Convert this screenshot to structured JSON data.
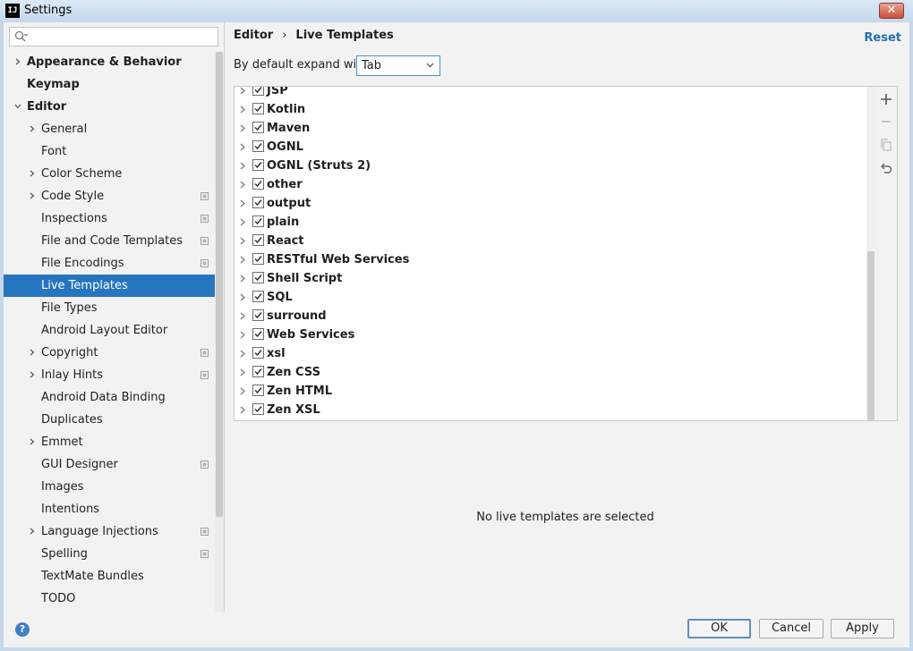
{
  "window": {
    "title": "Settings",
    "icon_text": "IJ",
    "close_label": "✕"
  },
  "search": {
    "placeholder": ""
  },
  "sidebar": {
    "items": [
      {
        "label": "Appearance & Behavior",
        "level": 0,
        "arrow": "right",
        "bold": true,
        "project": false,
        "selected": false
      },
      {
        "label": "Keymap",
        "level": 0,
        "arrow": "none",
        "bold": true,
        "project": false,
        "selected": false
      },
      {
        "label": "Editor",
        "level": 0,
        "arrow": "down",
        "bold": true,
        "project": false,
        "selected": false
      },
      {
        "label": "General",
        "level": 1,
        "arrow": "right",
        "bold": false,
        "project": false,
        "selected": false
      },
      {
        "label": "Font",
        "level": 1,
        "arrow": "none",
        "bold": false,
        "project": false,
        "selected": false
      },
      {
        "label": "Color Scheme",
        "level": 1,
        "arrow": "right",
        "bold": false,
        "project": false,
        "selected": false
      },
      {
        "label": "Code Style",
        "level": 1,
        "arrow": "right",
        "bold": false,
        "project": true,
        "selected": false
      },
      {
        "label": "Inspections",
        "level": 1,
        "arrow": "none",
        "bold": false,
        "project": true,
        "selected": false
      },
      {
        "label": "File and Code Templates",
        "level": 1,
        "arrow": "none",
        "bold": false,
        "project": true,
        "selected": false
      },
      {
        "label": "File Encodings",
        "level": 1,
        "arrow": "none",
        "bold": false,
        "project": true,
        "selected": false
      },
      {
        "label": "Live Templates",
        "level": 1,
        "arrow": "none",
        "bold": false,
        "project": false,
        "selected": true
      },
      {
        "label": "File Types",
        "level": 1,
        "arrow": "none",
        "bold": false,
        "project": false,
        "selected": false
      },
      {
        "label": "Android Layout Editor",
        "level": 1,
        "arrow": "none",
        "bold": false,
        "project": false,
        "selected": false
      },
      {
        "label": "Copyright",
        "level": 1,
        "arrow": "right",
        "bold": false,
        "project": true,
        "selected": false
      },
      {
        "label": "Inlay Hints",
        "level": 1,
        "arrow": "right",
        "bold": false,
        "project": true,
        "selected": false
      },
      {
        "label": "Android Data Binding",
        "level": 1,
        "arrow": "none",
        "bold": false,
        "project": false,
        "selected": false
      },
      {
        "label": "Duplicates",
        "level": 1,
        "arrow": "none",
        "bold": false,
        "project": false,
        "selected": false
      },
      {
        "label": "Emmet",
        "level": 1,
        "arrow": "right",
        "bold": false,
        "project": false,
        "selected": false
      },
      {
        "label": "GUI Designer",
        "level": 1,
        "arrow": "none",
        "bold": false,
        "project": true,
        "selected": false
      },
      {
        "label": "Images",
        "level": 1,
        "arrow": "none",
        "bold": false,
        "project": false,
        "selected": false
      },
      {
        "label": "Intentions",
        "level": 1,
        "arrow": "none",
        "bold": false,
        "project": false,
        "selected": false
      },
      {
        "label": "Language Injections",
        "level": 1,
        "arrow": "right",
        "bold": false,
        "project": true,
        "selected": false
      },
      {
        "label": "Spelling",
        "level": 1,
        "arrow": "none",
        "bold": false,
        "project": true,
        "selected": false
      },
      {
        "label": "TextMate Bundles",
        "level": 1,
        "arrow": "none",
        "bold": false,
        "project": false,
        "selected": false
      },
      {
        "label": "TODO",
        "level": 1,
        "arrow": "none",
        "bold": false,
        "project": false,
        "selected": false
      }
    ]
  },
  "content": {
    "breadcrumb": [
      "Editor",
      "Live Templates"
    ],
    "breadcrumb_separator": "›",
    "reset_label": "Reset",
    "expand_label": "By default expand with",
    "expand_value": "Tab",
    "template_groups": [
      {
        "name": "JSP",
        "checked": true
      },
      {
        "name": "Kotlin",
        "checked": true
      },
      {
        "name": "Maven",
        "checked": true
      },
      {
        "name": "OGNL",
        "checked": true
      },
      {
        "name": "OGNL (Struts 2)",
        "checked": true
      },
      {
        "name": "other",
        "checked": true
      },
      {
        "name": "output",
        "checked": true
      },
      {
        "name": "plain",
        "checked": true
      },
      {
        "name": "React",
        "checked": true
      },
      {
        "name": "RESTful Web Services",
        "checked": true
      },
      {
        "name": "Shell Script",
        "checked": true
      },
      {
        "name": "SQL",
        "checked": true
      },
      {
        "name": "surround",
        "checked": true
      },
      {
        "name": "Web Services",
        "checked": true
      },
      {
        "name": "xsl",
        "checked": true
      },
      {
        "name": "Zen CSS",
        "checked": true
      },
      {
        "name": "Zen HTML",
        "checked": true
      },
      {
        "name": "Zen XSL",
        "checked": true
      }
    ],
    "toolbar": [
      "add-icon",
      "remove-icon",
      "copy-icon",
      "restore-icon"
    ],
    "empty_message": "No live templates are selected"
  },
  "footer": {
    "help_label": "?",
    "ok_label": "OK",
    "cancel_label": "Cancel",
    "apply_label": "Apply"
  },
  "colors": {
    "selection": "#2675bf",
    "link": "#2470b3",
    "background": "#f2f2f2"
  }
}
